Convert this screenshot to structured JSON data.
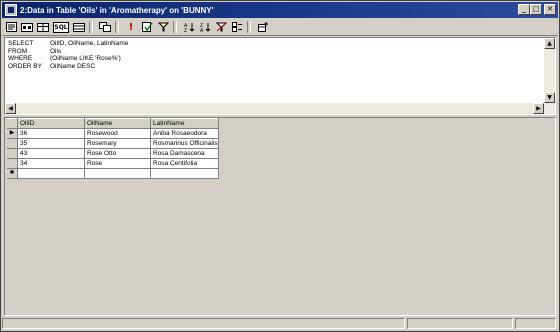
{
  "window": {
    "title": "2:Data in Table 'Oils' in 'Aromatherapy' on 'BUNNY'",
    "minimize_glyph": "_",
    "maximize_glyph": "□",
    "close_glyph": "✕"
  },
  "toolbar": {
    "sql_label": "SQL",
    "run_glyph": "!"
  },
  "sql": {
    "lines": [
      {
        "keyword": "SELECT",
        "text": "OilID, OilName, LatinName"
      },
      {
        "keyword": "FROM",
        "text": "Oils"
      },
      {
        "keyword": "WHERE",
        "text": "(OilName LIKE 'Rose%')"
      },
      {
        "keyword": "ORDER BY",
        "text": "OilName DESC"
      }
    ]
  },
  "scroll": {
    "up": "▲",
    "down": "▼",
    "left": "◀",
    "right": "▶"
  },
  "grid": {
    "columns": [
      "OilID",
      "OilName",
      "LatinName"
    ],
    "rows": [
      {
        "marker": "▶",
        "cells": [
          "36",
          "Rosewood",
          "Aniba Rosaeodora"
        ]
      },
      {
        "marker": "",
        "cells": [
          "35",
          "Rosemary",
          "Rosmarinus Officinalis"
        ]
      },
      {
        "marker": "",
        "cells": [
          "43",
          "Rose Otto",
          "Rosa Damascena"
        ]
      },
      {
        "marker": "",
        "cells": [
          "34",
          "Rose",
          "Rosa Centifolia"
        ]
      }
    ],
    "new_row_marker": "✱"
  }
}
